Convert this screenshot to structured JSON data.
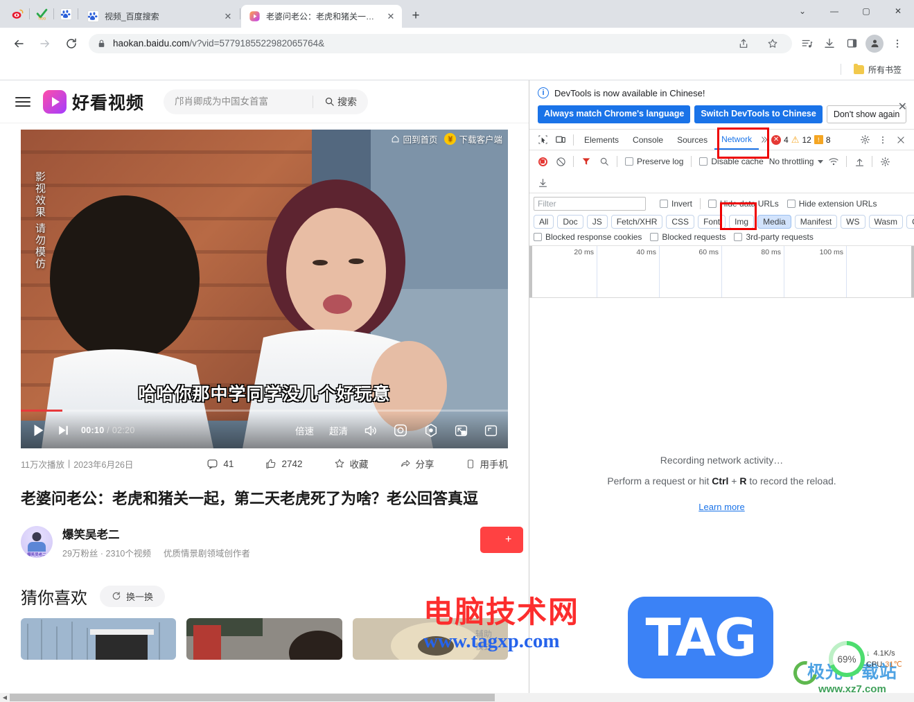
{
  "browser": {
    "pinned_tabs": [
      {
        "name": "weibo-favicon",
        "label": "微博"
      },
      {
        "name": "hao123-favicon",
        "label": "hao123"
      },
      {
        "name": "baidu-favicon",
        "label": "百度"
      }
    ],
    "tabs": [
      {
        "title": "视频_百度搜索",
        "active": false,
        "favicon": "baidu-favicon"
      },
      {
        "title": "老婆问老公：老虎和猪关一起，",
        "active": true,
        "favicon": "haokan-favicon"
      }
    ],
    "new_tab_label": "+",
    "window_controls": {
      "minimize": "—",
      "maximize": "▢",
      "close": "✕",
      "more": "⌄"
    },
    "toolbar": {
      "back": "←",
      "forward": "→",
      "reload": "⟳",
      "lock_icon": "lock-icon",
      "url_host": "haokan.baidu.com",
      "url_rest": "/v?vid=5779185522982065764&",
      "share_icon": "share-icon",
      "bookmark_icon": "star-icon",
      "reading_list_icon": "reading-list-icon",
      "download_icon": "download-icon",
      "sidepanel_icon": "side-panel-icon",
      "profile_icon": "profile-avatar-icon",
      "menu_icon": "three-dot-menu-icon"
    },
    "bookmark_bar": {
      "all_bookmarks_label": "所有书签"
    }
  },
  "site": {
    "menu_icon": "hamburger-icon",
    "brand_name": "好看视频",
    "search": {
      "value": "邝肖卿成为中国女首富",
      "placeholder": "邝肖卿成为中国女首富",
      "button_label": "搜索",
      "icon": "search-icon"
    },
    "video_overlay": {
      "home_label": "回到首页",
      "download_label": "下载客户端",
      "coin_glyph": "¥",
      "vertical_warning": "影视效果 请勿模仿",
      "subtitle": "哈哈你那中学同学没几个好玩意"
    },
    "player_controls": {
      "play_icon": "play-icon",
      "next_icon": "next-episode-icon",
      "current_time": "00:10",
      "separator": "/",
      "total_time": "02:20",
      "speed_label": "倍速",
      "quality_label": "超清",
      "volume_icon": "volume-icon",
      "settings_icon": "settings-gear-icon",
      "capture_icon": "capture-icon",
      "pip_icon": "picture-in-picture-icon",
      "fullscreen_icon": "fullscreen-icon",
      "progress_percent": 8.5
    },
    "meta": {
      "plays": "11万次播放",
      "divider": "|",
      "date": "2023年6月26日",
      "actions": [
        {
          "name": "comment",
          "icon": "comment-icon",
          "label": "41"
        },
        {
          "name": "like",
          "icon": "thumbs-up-icon",
          "label": "2742"
        },
        {
          "name": "favorite",
          "icon": "star-outline-icon",
          "label": "收藏"
        },
        {
          "name": "share",
          "icon": "share-arrow-icon",
          "label": "分享"
        },
        {
          "name": "phone-watch",
          "icon": "phone-icon",
          "label": "用手机"
        }
      ]
    },
    "video_title": "老婆问老公：老虎和猪关一起，第二天老虎死了为啥？老公回答真逗",
    "author": {
      "avatar_tag": "爆笑吴老二",
      "name": "爆笑吴老二",
      "fans": "29万粉丝",
      "dot": "·",
      "videos": "2310个视频",
      "tagline": "优质情景剧领域创作者",
      "follow_label": "+"
    },
    "recommend": {
      "heading": "猜你喜欢",
      "refresh_label": "换一换",
      "refresh_icon": "refresh-icon"
    },
    "assist_mode": "辅助\n模式"
  },
  "devtools": {
    "banner": {
      "message": "DevTools is now available in Chinese!",
      "info_icon": "info-icon",
      "btn_match_language": "Always match Chrome's language",
      "btn_switch_chinese": "Switch DevTools to Chinese",
      "btn_dont_show": "Don't show again",
      "close_icon": "close-icon"
    },
    "tabbar": {
      "inspect_icon": "inspect-element-icon",
      "device_icon": "device-toolbar-icon",
      "tabs": [
        "Elements",
        "Console",
        "Sources",
        "Network"
      ],
      "active_tab": "Network",
      "overflow_icon": "more-tabs-chevron-icon",
      "error_count": "4",
      "warning_count": "12",
      "message_count": "8",
      "settings_icon": "settings-gear-icon",
      "more_icon": "three-dot-menu-icon",
      "close_icon": "close-devtools-icon"
    },
    "network_toolbar": {
      "record_icon": "record-stop-icon",
      "clear_icon": "clear-network-icon",
      "filter_icon": "filter-funnel-icon",
      "search_icon": "search-icon",
      "preserve_log": "Preserve log",
      "disable_cache": "Disable cache",
      "throttling": "No throttling",
      "wifi_icon": "network-conditions-icon",
      "import_icon": "import-har-icon",
      "export_icon": "export-har-icon",
      "settings_icon": "network-settings-icon"
    },
    "filters": {
      "input_placeholder": "Filter",
      "input_value": "",
      "invert": "Invert",
      "hide_data_urls": "Hide data URLs",
      "hide_extension_urls": "Hide extension URLs",
      "types": [
        "All",
        "Doc",
        "JS",
        "Fetch/XHR",
        "CSS",
        "Font",
        "Img",
        "Media",
        "Manifest",
        "WS",
        "Wasm",
        "Other"
      ],
      "selected_type": "Media",
      "blocked_response_cookies": "Blocked response cookies",
      "blocked_requests": "Blocked requests",
      "third_party_requests": "3rd-party requests"
    },
    "timeline": {
      "ticks": [
        "20 ms",
        "40 ms",
        "60 ms",
        "80 ms",
        "100 ms"
      ]
    },
    "empty_state": {
      "line1": "Recording network activity…",
      "line2_pre": "Perform a request or hit ",
      "line2_key1": "Ctrl",
      "line2_plus": " + ",
      "line2_key2": "R",
      "line2_post": " to record the reload.",
      "learn_more": "Learn more"
    },
    "annotations": [
      {
        "name": "network-tab-highlight"
      },
      {
        "name": "media-filter-highlight"
      }
    ]
  },
  "watermarks": {
    "main_cn": "电脑技术网",
    "main_url": "www.tagxp.com",
    "tag_logo": "TAG",
    "xz_cn": "极光下载站",
    "xz_url": "www.xz7.com"
  },
  "system_widget": {
    "cpu_percent": "69%",
    "net_arrow": "↓",
    "net_speed": "4.1K/s",
    "cpu_label": "CPU",
    "cpu_temp": "31℃"
  }
}
